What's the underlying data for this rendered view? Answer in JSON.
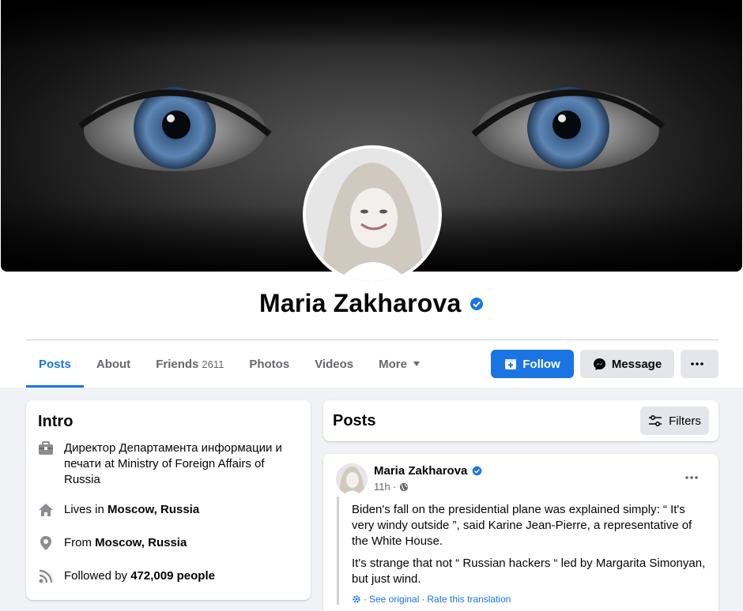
{
  "profile": {
    "name": "Maria Zakharova"
  },
  "tabs": [
    {
      "label": "Posts"
    },
    {
      "label": "About"
    },
    {
      "label": "Friends",
      "count": "2611"
    },
    {
      "label": "Photos"
    },
    {
      "label": "Videos"
    },
    {
      "label": "More"
    }
  ],
  "actions": {
    "follow": "Follow",
    "message": "Message"
  },
  "intro": {
    "title": "Intro",
    "work": {
      "prefix": "Директор Департамента информации и печати at ",
      "org": "Ministry of Foreign Affairs of Russia"
    },
    "lives": {
      "prefix": "Lives in ",
      "place": "Moscow, Russia"
    },
    "from": {
      "prefix": "From ",
      "place": "Moscow, Russia"
    },
    "followers": {
      "prefix": "Followed by ",
      "count": "472,009 people"
    }
  },
  "posts": {
    "title": "Posts",
    "filters_label": "Filters",
    "items": [
      {
        "author": "Maria Zakharova",
        "time": "11h",
        "paragraphs": [
          "Biden's fall on the presidential plane was explained simply: “ It's very windy outside ”, said Karine Jean-Pierre, a representative of the White House.",
          "It's strange that not “ Russian hackers “ led by Margarita Simonyan, but just wind."
        ],
        "see_original": "See original",
        "separator": "·",
        "rate_translation": "Rate this translation"
      }
    ]
  },
  "colors": {
    "accent": "#1b74e4",
    "page_bg": "#f0f2f5",
    "secondary_button": "#e4e6eb",
    "muted_text": "#65676b"
  }
}
